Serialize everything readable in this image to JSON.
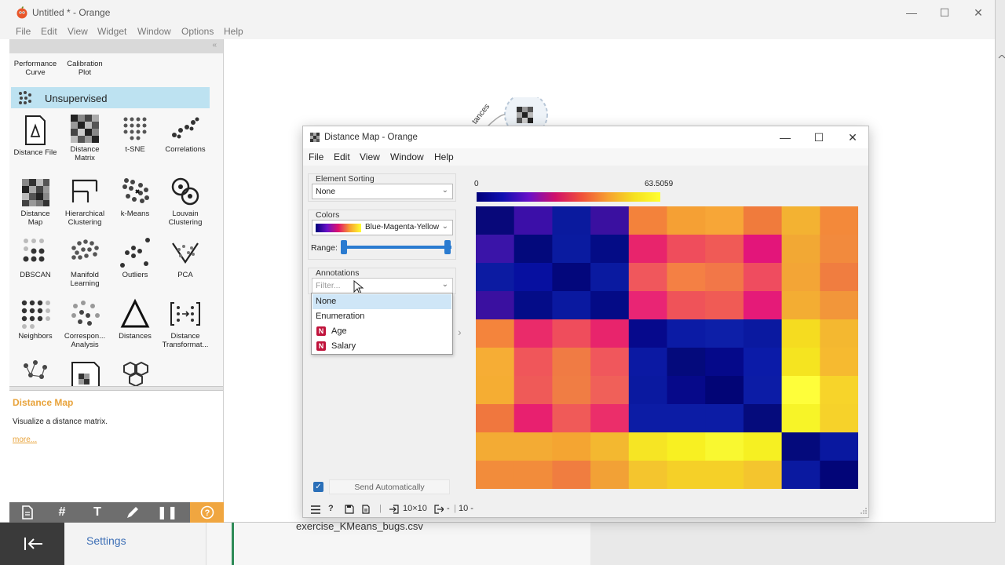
{
  "main_window": {
    "title": "Untitled * - Orange",
    "menu": [
      "File",
      "Edit",
      "View",
      "Widget",
      "Window",
      "Options",
      "Help"
    ]
  },
  "toolbox": {
    "top_widgets": [
      {
        "label": "Performance\nCurve"
      },
      {
        "label": "Calibration\nPlot"
      }
    ],
    "category": "Unsupervised",
    "widgets": [
      {
        "label": "Distance File",
        "icon": "distance-file-icon"
      },
      {
        "label": "Distance\nMatrix",
        "icon": "distance-matrix-icon"
      },
      {
        "label": "t-SNE",
        "icon": "tsne-icon"
      },
      {
        "label": "Correlations",
        "icon": "correlations-icon"
      },
      {
        "label": "Distance\nMap",
        "icon": "distance-map-icon"
      },
      {
        "label": "Hierarchical\nClustering",
        "icon": "hierarchical-clustering-icon"
      },
      {
        "label": "k-Means",
        "icon": "kmeans-icon"
      },
      {
        "label": "Louvain\nClustering",
        "icon": "louvain-clustering-icon"
      },
      {
        "label": "DBSCAN",
        "icon": "dbscan-icon"
      },
      {
        "label": "Manifold\nLearning",
        "icon": "manifold-learning-icon"
      },
      {
        "label": "Outliers",
        "icon": "outliers-icon"
      },
      {
        "label": "PCA",
        "icon": "pca-icon"
      },
      {
        "label": "Neighbors",
        "icon": "neighbors-icon"
      },
      {
        "label": "Correspon...\nAnalysis",
        "icon": "correspondence-analysis-icon"
      },
      {
        "label": "Distances",
        "icon": "distances-icon"
      },
      {
        "label": "Distance\nTransformat...",
        "icon": "distance-transformation-icon"
      }
    ],
    "help": {
      "title": "Distance Map",
      "description": "Visualize a distance matrix.",
      "more": "more..."
    }
  },
  "canvas": {
    "node_label": "tances"
  },
  "background": {
    "settings_label": "Settings",
    "file_label": "exercise_KMeans_bugs.csv"
  },
  "distance_map": {
    "title": "Distance Map - Orange",
    "menu": [
      "File",
      "Edit",
      "View",
      "Window",
      "Help"
    ],
    "element_sorting": {
      "title": "Element Sorting",
      "value": "None"
    },
    "colors": {
      "title": "Colors",
      "palette": "Blue-Magenta-Yellow",
      "range_label": "Range:"
    },
    "annotations": {
      "title": "Annotations",
      "filter_placeholder": "Filter...",
      "options": [
        {
          "label": "None",
          "selected": true,
          "type": ""
        },
        {
          "label": "Enumeration",
          "selected": false,
          "type": ""
        },
        {
          "label": "Age",
          "selected": false,
          "type": "N"
        },
        {
          "label": "Salary",
          "selected": false,
          "type": "N"
        }
      ]
    },
    "send_automatically": {
      "label": "Send Automatically",
      "checked": true
    },
    "status": {
      "size_in": "10×10",
      "size_out": "10 -",
      "sep": "|"
    },
    "colorbar": {
      "min": "0",
      "max": "63.5059"
    },
    "heatmap_colors": [
      [
        "#08087a",
        "#3b0fa8",
        "#0a1a9e",
        "#3a10a0",
        "#f3823b",
        "#f5a034",
        "#f7a637",
        "#f07b3c",
        "#f3b232",
        "#f3893a"
      ],
      [
        "#3a14a8",
        "#03097c",
        "#0a1ba0",
        "#040c86",
        "#e8246c",
        "#ef4d5c",
        "#f05a56",
        "#e3157a",
        "#f2a834",
        "#f28a3d"
      ],
      [
        "#0c1ba2",
        "#0710a0",
        "#03077c",
        "#0a1aa0",
        "#f0575c",
        "#f48044",
        "#f27748",
        "#ef4c5f",
        "#f3a536",
        "#f07d40"
      ],
      [
        "#3a10a0",
        "#040c88",
        "#0a19a0",
        "#040b86",
        "#e92574",
        "#ef5359",
        "#f05b55",
        "#e51a78",
        "#f3ad33",
        "#f2963a"
      ],
      [
        "#f4843c",
        "#ea2b6a",
        "#ef4d5c",
        "#e8246c",
        "#06098c",
        "#0b1ba5",
        "#0d1fa8",
        "#0a19a0",
        "#f5dc20",
        "#f4b830"
      ],
      [
        "#f6ad35",
        "#f0565a",
        "#f07b44",
        "#f0575c",
        "#0b19a3",
        "#040a7c",
        "#05098a",
        "#0b1ba8",
        "#f5e420",
        "#f6ba30"
      ],
      [
        "#f5ad33",
        "#ef5a58",
        "#f07d44",
        "#f06059",
        "#0a19a0",
        "#06098a",
        "#020576",
        "#0c1ca6",
        "#fefe3a",
        "#f7d42a"
      ],
      [
        "#f0773e",
        "#e8206f",
        "#f05a58",
        "#eb2e6a",
        "#0c1ca5",
        "#0c1ca5",
        "#0c1ca5",
        "#050b7c",
        "#f7f428",
        "#f6d22a"
      ],
      [
        "#f3ab34",
        "#f3ab34",
        "#f4a532",
        "#f3b830",
        "#f6e524",
        "#f8f022",
        "#f9f830",
        "#f6f022",
        "#040a7c",
        "#0918a0"
      ],
      [
        "#f28c3b",
        "#f28c3b",
        "#f07d40",
        "#f2a136",
        "#f4c52e",
        "#f5d028",
        "#f5d028",
        "#f4c52e",
        "#0a19a0",
        "#020578"
      ]
    ]
  }
}
